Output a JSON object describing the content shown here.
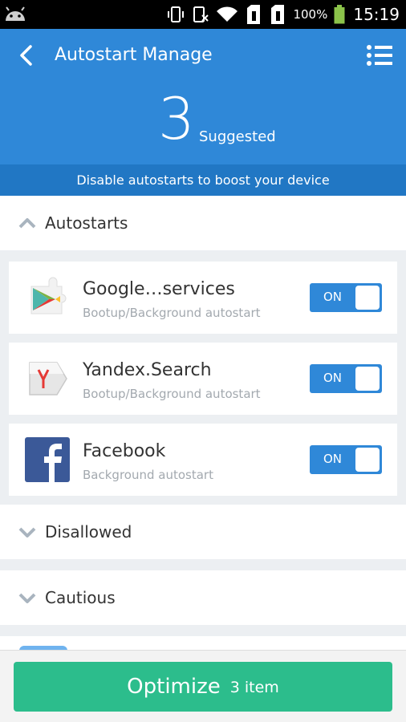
{
  "status_bar": {
    "battery_percent": "100%",
    "time": "15:19",
    "icons": [
      "android-icon",
      "vibrate-icon",
      "data-off-icon",
      "wifi-icon",
      "sim1-icon",
      "sim2-icon",
      "battery-icon"
    ]
  },
  "header": {
    "title": "Autostart Manage",
    "count": "3",
    "count_label": "Suggested",
    "subtitle": "Disable autostarts to boost your device",
    "accent_color": "#2f88d8"
  },
  "sections": {
    "autostarts": "Autostarts",
    "disallowed": "Disallowed",
    "cautious": "Cautious"
  },
  "apps": [
    {
      "name": "Google…services",
      "desc": "Bootup/Background autostart",
      "toggle": "ON",
      "icon": "google-play-services-icon"
    },
    {
      "name": "Yandex.Search",
      "desc": "Bootup/Background autostart",
      "toggle": "ON",
      "icon": "yandex-search-icon"
    },
    {
      "name": "Facebook",
      "desc": "Background autostart",
      "toggle": "ON",
      "icon": "facebook-icon"
    }
  ],
  "footer": {
    "button_label": "Optimize",
    "button_count": "3 item",
    "button_color": "#2cbd8c"
  }
}
